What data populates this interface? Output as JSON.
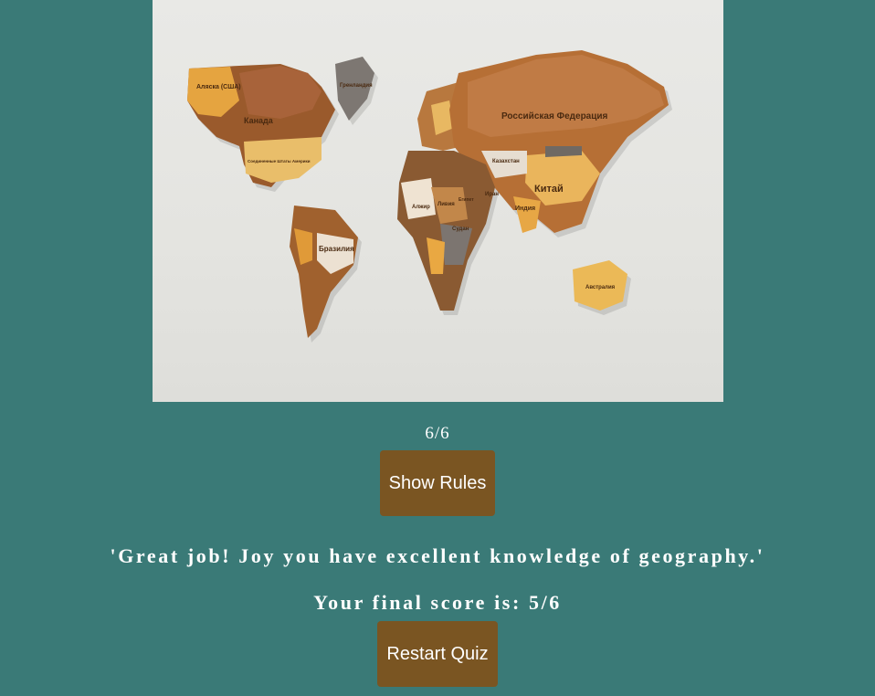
{
  "image": {
    "alt": "",
    "labels": {
      "alaska": "Аляска (США)",
      "canada": "Канада",
      "greenland": "Гренландия",
      "usa": "Соединенные Штаты Америки",
      "russia": "Российская Федерация",
      "kazakhstan": "Казахстан",
      "china": "Китай",
      "india": "Индия",
      "iran": "Иран",
      "algeria": "Алжир",
      "libya": "Ливия",
      "egypt": "Египет",
      "sudan": "Судан",
      "brazil": "Бразилия",
      "australia": "Австралия"
    }
  },
  "quiz": {
    "progress": "6/6",
    "show_rules_label": "Show Rules",
    "result_message": "'Great job! Joy you have excellent knowledge of geography.'",
    "final_score_text": "Your final score is: 5/6",
    "restart_label": "Restart Quiz"
  },
  "colors": {
    "background": "#3a7a77",
    "button": "#7a5522",
    "text": "#ffffff"
  }
}
